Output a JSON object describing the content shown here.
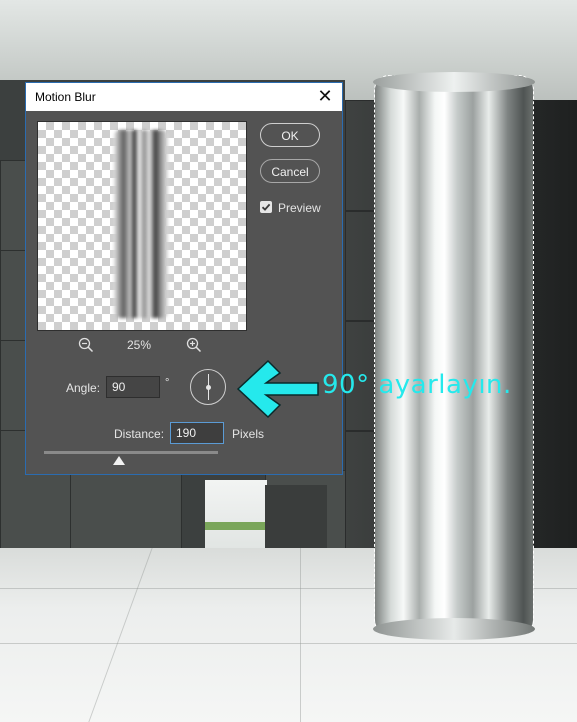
{
  "dialog": {
    "title": "Motion Blur",
    "close_label": "✕",
    "ok_label": "OK",
    "cancel_label": "Cancel",
    "preview_label": "Preview",
    "preview_checked": true,
    "zoom_level": "25%",
    "angle_label": "Angle:",
    "angle_value": "90",
    "degree_symbol": "°",
    "distance_label": "Distance:",
    "distance_value": "190",
    "pixels_label": "Pixels",
    "distance_slider_fraction": 0.43
  },
  "annotation": {
    "text": "90° ayarlayın.",
    "color": "#25e9ec"
  },
  "icons": {
    "zoom_out": "zoom-out-icon",
    "zoom_in": "zoom-in-icon",
    "angle_dial": "angle-dial-icon",
    "arrow": "arrow-left-icon"
  }
}
